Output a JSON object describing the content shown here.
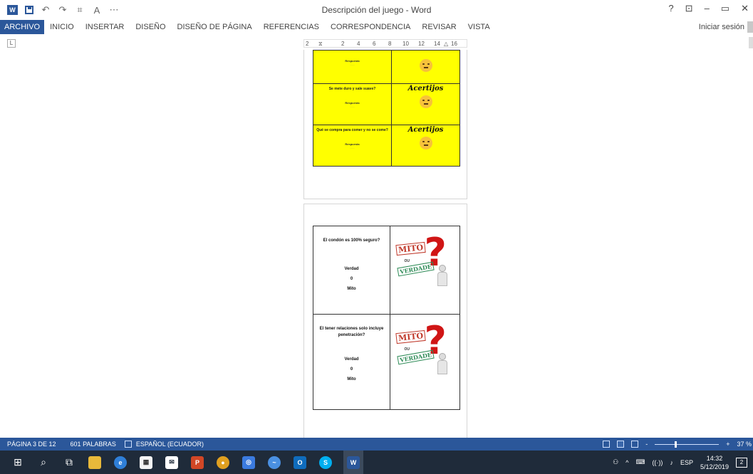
{
  "titlebar": {
    "doc_title": "Descripción del juego - Word",
    "qat_undo": "↶",
    "qat_redo": "↷",
    "word_logo": "W",
    "help": "?",
    "ribbon_display": "⊡",
    "minimize": "–",
    "restore": "▭",
    "close": "✕"
  },
  "ribbon": {
    "tabs": [
      "ARCHIVO",
      "INICIO",
      "INSERTAR",
      "DISEÑO",
      "DISEÑO DE PÁGINA",
      "REFERENCIAS",
      "CORRESPONDENCIA",
      "REVISAR",
      "VISTA"
    ],
    "signin": "Iniciar sesión"
  },
  "ruler": {
    "tab_selector": "L",
    "marks": [
      "2",
      "2",
      "4",
      "6",
      "8",
      "10",
      "12",
      "14",
      "16"
    ]
  },
  "page1": {
    "rows": [
      {
        "question": "",
        "answer_label": "Respuesta",
        "answer_sub": "........",
        "right_title": ""
      },
      {
        "question": "Se mete duro y sale suave?",
        "answer_label": "Respuesta",
        "answer_sub": "........",
        "right_title": "Acertijos"
      },
      {
        "question": "Qué se compra para comer y no se come?",
        "answer_label": "Respuesta",
        "answer_sub": "........",
        "right_title": "Acertijos"
      }
    ]
  },
  "page2": {
    "cards": [
      {
        "question": "El condón es 100% seguro?",
        "opt1": "Verdad",
        "opt2": "0",
        "opt3": "Mito",
        "img_mito": "MITO",
        "img_ou": "OU",
        "img_verdad": "VERDADE",
        "img_q": "?"
      },
      {
        "question": "El tener relaciones solo incluye penetración?",
        "opt1": "Verdad",
        "opt2": "0",
        "opt3": "Mito",
        "img_mito": "MITO",
        "img_ou": "OU",
        "img_verdad": "VERDADE",
        "img_q": "?"
      }
    ]
  },
  "statusbar": {
    "page": "PÁGINA 3 DE 12",
    "words": "601 PALABRAS",
    "language": "ESPAÑOL (ECUADOR)",
    "zoom_minus": "-",
    "zoom_plus": "+",
    "zoom": "37 %"
  },
  "taskbar": {
    "start": "⊞",
    "search": "⌕",
    "taskview": "⧉",
    "apps": [
      "file-explorer",
      "edge",
      "store",
      "mail",
      "powerpoint",
      "chrome",
      "app-blue",
      "app-swift",
      "outlook",
      "skype",
      "word"
    ],
    "tray_up": "^",
    "ime": "⌨",
    "wifi": "((·))",
    "volume": "♪",
    "lang": "ESP",
    "time": "14:32",
    "date": "5/12/2019",
    "notif_count": "2"
  },
  "colors": {
    "accent": "#2b579a",
    "taskbar": "#1f2b3a",
    "card_yellow": "#ffff00"
  }
}
